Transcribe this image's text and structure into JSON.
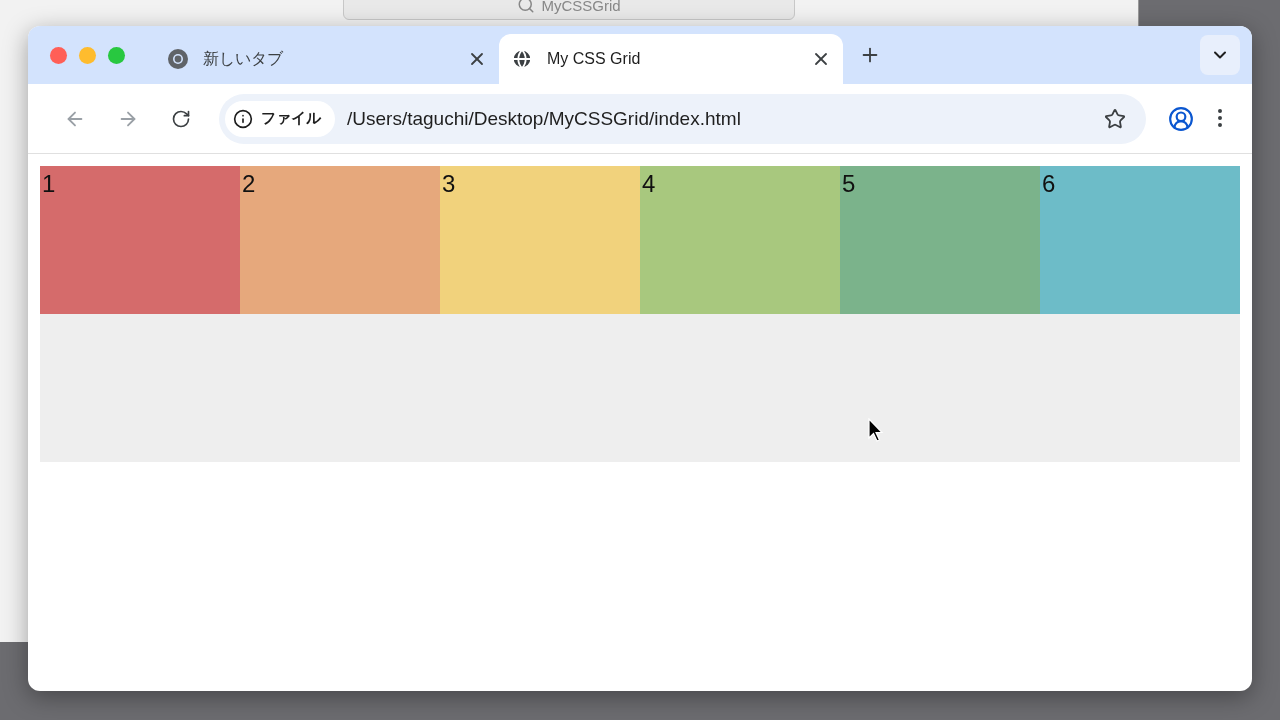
{
  "back_window": {
    "search": "MyCSSGrid"
  },
  "browser": {
    "tabs": [
      {
        "title": "新しいタブ",
        "kind": "chrome",
        "selected": false
      },
      {
        "title": "My CSS Grid",
        "kind": "globe",
        "selected": true
      }
    ],
    "address": {
      "chip": "ファイル",
      "url": "/Users/taguchi/Desktop/MyCSSGrid/index.html"
    }
  },
  "page": {
    "cells": [
      {
        "label": "1",
        "color": "#d56b6b"
      },
      {
        "label": "2",
        "color": "#e6a87c"
      },
      {
        "label": "3",
        "color": "#f1d27c"
      },
      {
        "label": "4",
        "color": "#a8c87e"
      },
      {
        "label": "5",
        "color": "#7bb38b"
      },
      {
        "label": "6",
        "color": "#6dbcc8"
      }
    ]
  }
}
